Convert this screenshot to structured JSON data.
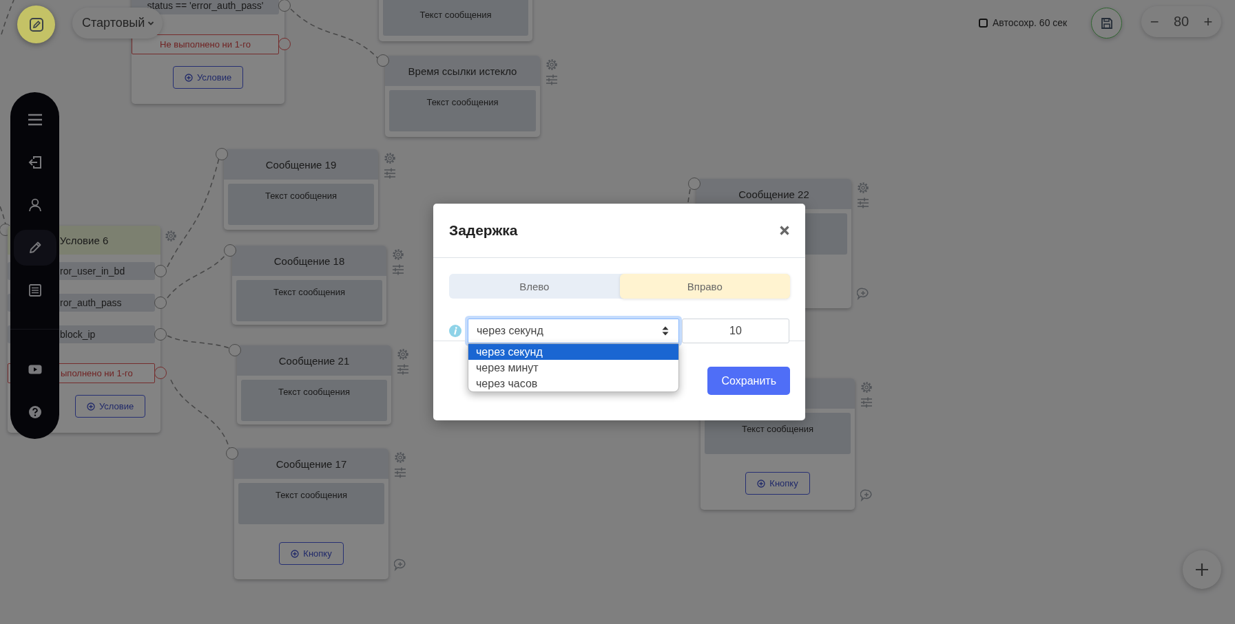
{
  "toolbar": {
    "flow_select": "Стартовый",
    "autosave": {
      "label": "Автосохр. 60 сек",
      "checked": false
    },
    "zoom": {
      "minus": "−",
      "value": "80",
      "plus": "+"
    }
  },
  "sidebar": {
    "items": [
      {
        "kind": "menu",
        "selected": false
      },
      {
        "kind": "exit",
        "selected": false
      },
      {
        "kind": "user",
        "selected": false
      },
      {
        "kind": "edit",
        "selected": true
      },
      {
        "kind": "list",
        "selected": false
      },
      {
        "kind": "video",
        "selected": false
      },
      {
        "kind": "help",
        "selected": false
      }
    ]
  },
  "canvas": {
    "nodes": [
      {
        "kind": "condition",
        "rows": [
          "status == 'error_auth_pass'"
        ],
        "fail_label": "Не выполнено ни 1-го",
        "add_button": "Условие"
      },
      {
        "kind": "message",
        "text": "Текст сообщения"
      },
      {
        "kind": "message",
        "title": "Время ссылки истекло",
        "text": "Текст сообщения"
      },
      {
        "kind": "message",
        "title": "Сообщение 19",
        "text": "Текст сообщения"
      },
      {
        "kind": "message",
        "title": "Сообщение 22"
      },
      {
        "kind": "condition",
        "title": "Условие 6",
        "rows": [
          "ror_user_in_bd",
          "ror_auth_pass",
          "block_ip"
        ],
        "fail_label": "ыполнено ни 1-го",
        "add_button": "Условие"
      },
      {
        "kind": "message",
        "title": "Сообщение 18",
        "text": "Текст сообщения"
      },
      {
        "kind": "message",
        "title": "Сообщение 21",
        "text": "Текст сообщения"
      },
      {
        "kind": "message",
        "text": "Текст сообщения",
        "add_button": "Кнопку"
      },
      {
        "kind": "message",
        "title": "Сообщение 17",
        "text": "Текст сообщения",
        "add_button": "Кнопку"
      }
    ]
  },
  "modal": {
    "title": "Задержка",
    "direction_tabs": [
      {
        "label": "Влево",
        "selected": false
      },
      {
        "label": "Вправо",
        "selected": true
      }
    ],
    "unit_select": {
      "value": "через секунд",
      "open": true,
      "options": [
        {
          "label": "через секунд",
          "selected": true
        },
        {
          "label": "через минут",
          "selected": false
        },
        {
          "label": "через часов",
          "selected": false
        }
      ]
    },
    "amount": "10",
    "save_button": "Сохранить"
  }
}
